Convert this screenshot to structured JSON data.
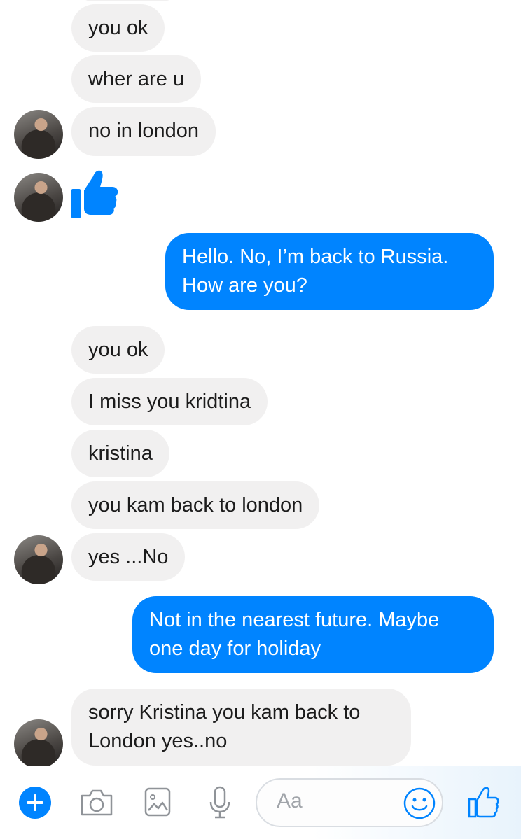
{
  "messages": [
    {
      "from": "them",
      "text": "you ok"
    },
    {
      "from": "them",
      "text": "wher are u"
    },
    {
      "from": "them",
      "text": "no in london"
    },
    {
      "from": "them",
      "type": "like-sticker"
    },
    {
      "from": "me",
      "lines": [
        "Hello. No, I’m back to Russia.",
        "How are you?"
      ]
    },
    {
      "from": "them",
      "text": "you ok"
    },
    {
      "from": "them",
      "text": "I miss you kridtina"
    },
    {
      "from": "them",
      "text": "kristina"
    },
    {
      "from": "them",
      "text": "you kam back to london"
    },
    {
      "from": "them",
      "text": "yes ...No"
    },
    {
      "from": "me",
      "lines": [
        "Not in the nearest future. Maybe",
        "one day for holiday"
      ]
    },
    {
      "from": "them",
      "lines": [
        "sorry Kristina you kam back to",
        "London yes..no"
      ]
    }
  ],
  "composer": {
    "placeholder": "Aa",
    "icons": [
      "plus-icon",
      "camera-icon",
      "image-icon",
      "microphone-icon",
      "emoji-icon",
      "like-icon"
    ]
  },
  "colors": {
    "accent": "#0084ff",
    "incoming_bubble": "#f1f0f0"
  }
}
